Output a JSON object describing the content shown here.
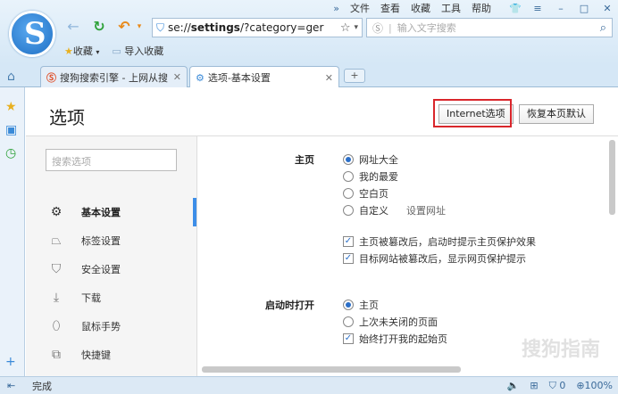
{
  "menubar": {
    "items": [
      "文件",
      "查看",
      "收藏",
      "工具",
      "帮助"
    ],
    "chevrons": "»"
  },
  "nav": {
    "back": "←",
    "refresh": "↻",
    "undo": "↶"
  },
  "address": {
    "prefix": "se://",
    "bold": "settings",
    "rest": "/?category=ger"
  },
  "search": {
    "placeholder": "输入文字搜索"
  },
  "bookmarks": {
    "favorites": "收藏",
    "import": "导入收藏"
  },
  "tabs": [
    {
      "label": "搜狗搜索引擎 - 上网从搜"
    },
    {
      "label": "选项-基本设置"
    }
  ],
  "page": {
    "title": "选项",
    "internet_button": "Internet选项",
    "restore_button": "恢复本页默认",
    "search_placeholder": "搜索选项"
  },
  "sidebar": {
    "items": [
      {
        "label": "基本设置"
      },
      {
        "label": "标签设置"
      },
      {
        "label": "安全设置"
      },
      {
        "label": "下载"
      },
      {
        "label": "鼠标手势"
      },
      {
        "label": "快捷键"
      }
    ]
  },
  "homepage": {
    "label": "主页",
    "options": [
      "网址大全",
      "我的最爱",
      "空白页",
      "自定义"
    ],
    "set_url": "设置网址",
    "checks": [
      "主页被篡改后，启动时提示主页保护效果",
      "目标网站被篡改后，显示网页保护提示"
    ]
  },
  "startup": {
    "label": "启动时打开",
    "options": [
      "主页",
      "上次未关闭的页面"
    ],
    "check": "始终打开我的起始页"
  },
  "watermark": "搜狗指南",
  "status": {
    "text": "完成",
    "zoom": "100%",
    "count": "0"
  }
}
